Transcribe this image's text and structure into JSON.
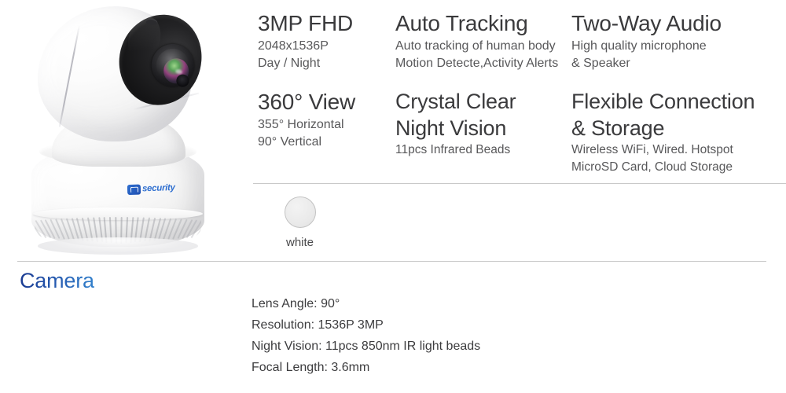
{
  "product": {
    "image_alt": "white-pan-tilt-wifi-security-camera",
    "logo_text": "security",
    "logo_mark": "zy-logo-icon"
  },
  "features": [
    {
      "title": "3MP FHD",
      "sub": [
        "2048x1536P",
        "Day / Night"
      ]
    },
    {
      "title": "Auto Tracking",
      "sub": [
        "Auto tracking of human body",
        "Motion Detecte,Activity Alerts"
      ]
    },
    {
      "title": "Two-Way Audio",
      "sub": [
        "High quality microphone",
        "& Speaker"
      ]
    },
    {
      "title": "360° View",
      "sub": [
        "355° Horizontal",
        "90° Vertical"
      ]
    },
    {
      "title_line1": "Crystal Clear",
      "title_line2": "Night Vision",
      "sub": [
        "11pcs Infrared Beads"
      ]
    },
    {
      "title_line1": "Flexible Connection",
      "title_line2": "& Storage",
      "sub": [
        "Wireless WiFi, Wired. Hotspot",
        "MicroSD Card, Cloud Storage"
      ]
    }
  ],
  "color_option": {
    "label": "white",
    "swatch_hex": "#ebebeb",
    "border_hex": "#c2c2c2"
  },
  "section": {
    "title": "Camera",
    "title_gradient_from": "#1b3b91",
    "title_gradient_to": "#3180cc",
    "specs": [
      "Lens Angle: 90°",
      "Resolution: 1536P 3MP",
      "Night Vision: 11pcs 850nm IR light beads",
      "Focal Length: 3.6mm"
    ]
  },
  "colors": {
    "divider": "#c9c9c9",
    "heading_text": "#3a3a3c",
    "body_text": "#58585a",
    "background": "#ffffff"
  }
}
